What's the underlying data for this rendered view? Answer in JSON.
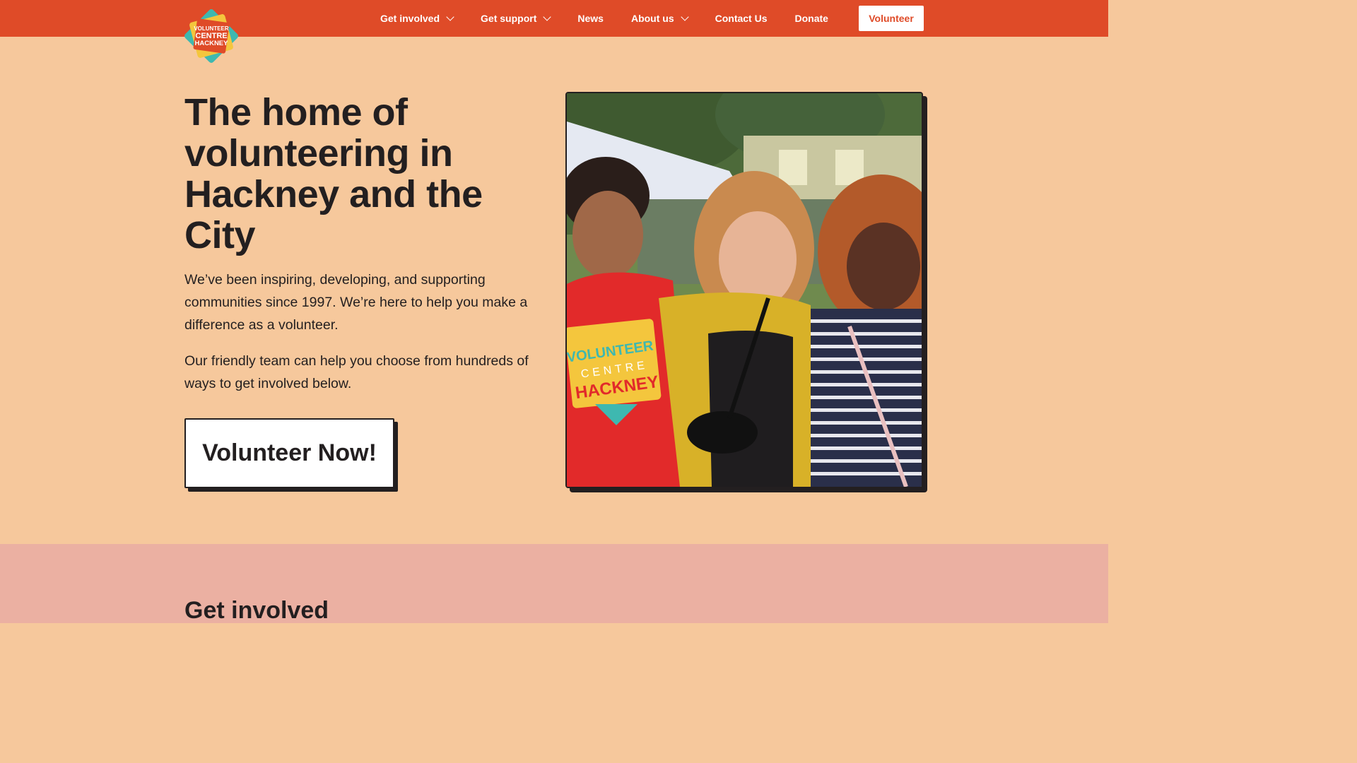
{
  "logo": {
    "lines": [
      "VOLUNTEER",
      "CENTRE",
      "HACKNEY"
    ]
  },
  "nav": {
    "items": [
      {
        "label": "Get involved",
        "has_dropdown": true
      },
      {
        "label": "Get support",
        "has_dropdown": true
      },
      {
        "label": "News",
        "has_dropdown": false
      },
      {
        "label": "About us",
        "has_dropdown": true
      },
      {
        "label": "Contact Us",
        "has_dropdown": false
      },
      {
        "label": "Donate",
        "has_dropdown": false
      }
    ],
    "cta_label": "Volunteer"
  },
  "hero": {
    "title": "The home of volunteering in Hackney and the City",
    "paragraph_1": "We’ve been inspiring, developing, and supporting communities since 1997. We’re here to help you make a difference as a volunteer.",
    "paragraph_2": "Our friendly team can help you choose from hundreds of ways to get involved below.",
    "cta_label": "Volunteer Now!",
    "photo_shirt_text": [
      "VOLUNTEER",
      "CENTRE",
      "HACKNEY"
    ]
  },
  "section_get_involved": {
    "title": "Get involved"
  },
  "colors": {
    "topbar": "#df4b28",
    "hero_bg": "#f6c89c",
    "section_bg": "#ebb0a2",
    "text": "#231f20"
  }
}
